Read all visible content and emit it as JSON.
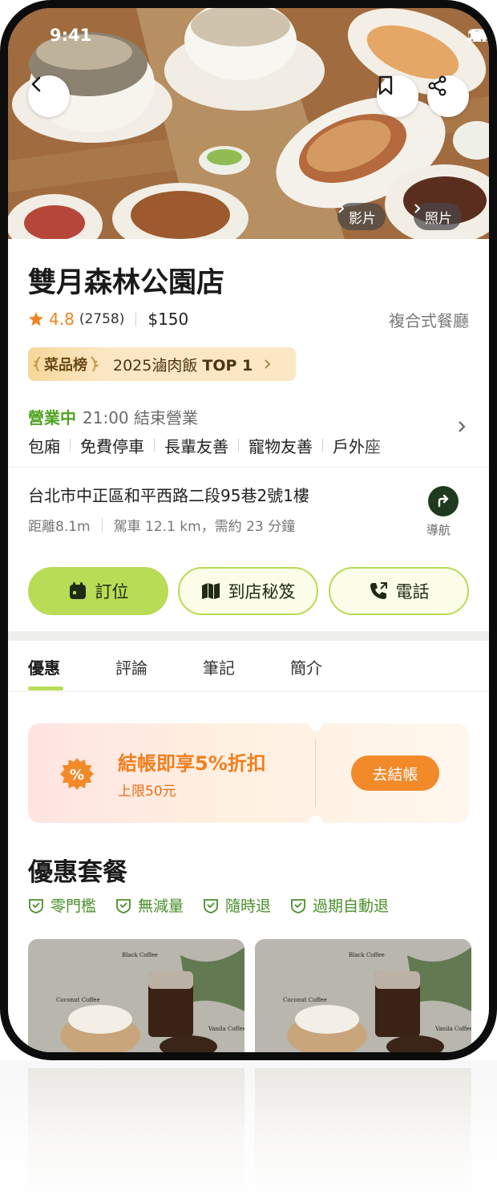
{
  "status": {
    "time": "9:41"
  },
  "hero": {
    "video_label": "影片",
    "photo_label": "照片"
  },
  "restaurant": {
    "name": "雙月森林公園店",
    "rating": "4.8",
    "review_count": "(2758)",
    "price": "$150",
    "category": "複合式餐廳"
  },
  "ranking": {
    "badge": "菜品榜",
    "text": "2025滷肉飯",
    "highlight": "TOP 1"
  },
  "hours": {
    "status": "營業中",
    "detail": "21:00 結束營業"
  },
  "facilities": [
    "包廂",
    "免費停車",
    "長輩友善",
    "寵物友善",
    "戶外座"
  ],
  "address": {
    "line": "台北市中正區和平西路二段95巷2號1樓",
    "distance": "距離8.1m",
    "drive": "駕車 12.1 km，需約 23 分鐘",
    "nav_label": "導航"
  },
  "actions": {
    "reserve": "訂位",
    "guide": "到店秘笈",
    "call": "電話"
  },
  "tabs": [
    "優惠",
    "評論",
    "筆記",
    "簡介"
  ],
  "coupon": {
    "title": "結帳即享5%折扣",
    "subtitle": "上限50元",
    "button": "去結帳"
  },
  "packages": {
    "title": "優惠套餐",
    "features": [
      "零門檻",
      "無減量",
      "隨時退",
      "過期自動退"
    ],
    "card_labels": [
      "Black Coffee",
      "Coconut Coffee",
      "Vanila Coffee"
    ]
  },
  "colors": {
    "accent_green": "#b8dc55",
    "open_green": "#4fa321",
    "star_orange": "#f0841f",
    "coupon_orange": "#f28a2a"
  }
}
